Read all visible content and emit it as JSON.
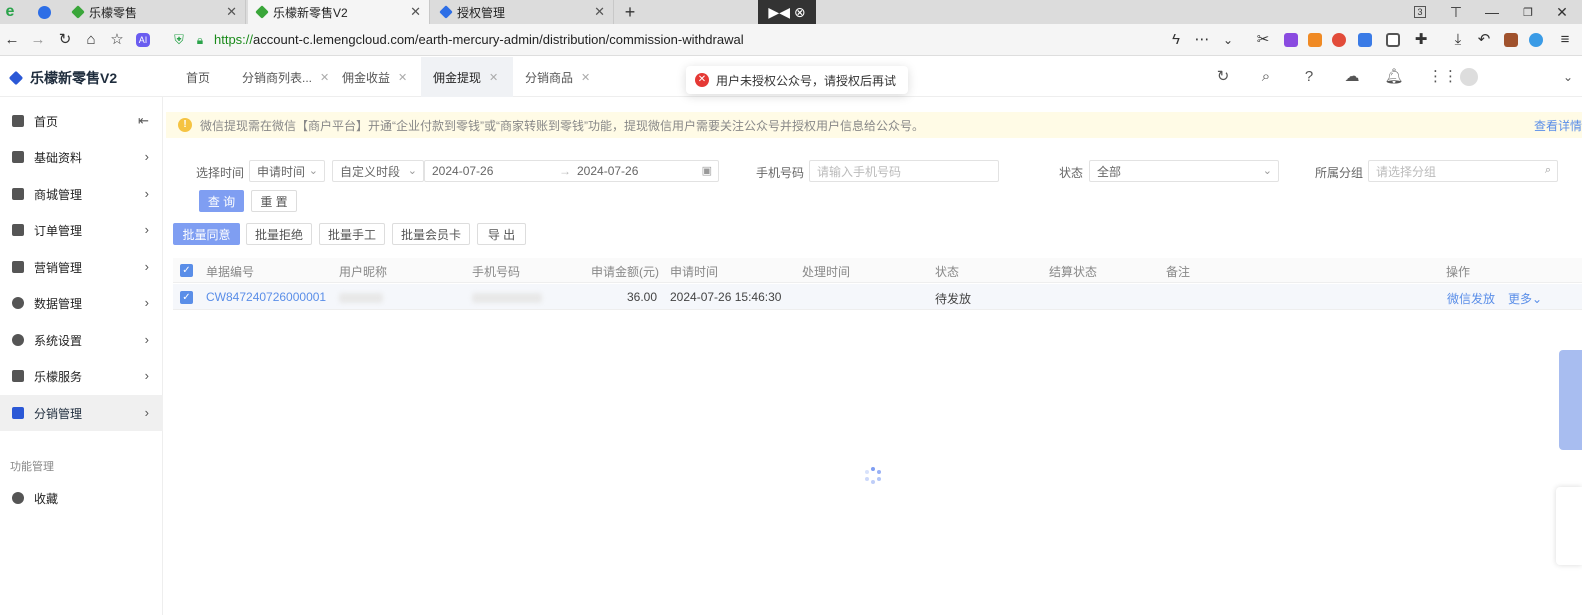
{
  "browser": {
    "tabs": [
      {
        "label": "乐檬零售"
      },
      {
        "label": "乐檬新零售V2"
      },
      {
        "label": "授权管理"
      }
    ],
    "tab_count_badge": "3",
    "url_scheme": "https://",
    "url_rest": "account-c.lemengcloud.com/earth-mercury-admin/distribution/commission-withdrawal"
  },
  "app": {
    "logo": "乐檬新零售V2",
    "page_tabs": [
      {
        "label": "首页",
        "closable": false
      },
      {
        "label": "分销商列表...",
        "closable": true
      },
      {
        "label": "佣金收益",
        "closable": true
      },
      {
        "label": "佣金提现",
        "closable": true,
        "active": true
      },
      {
        "label": "分销商品",
        "closable": true
      }
    ],
    "toast": "用户未授权公众号，请授权后再试"
  },
  "sidebar": {
    "items": [
      {
        "label": "首页",
        "icon": "home-icon"
      },
      {
        "label": "基础资料",
        "icon": "box-icon"
      },
      {
        "label": "商城管理",
        "icon": "shop-icon"
      },
      {
        "label": "订单管理",
        "icon": "order-icon"
      },
      {
        "label": "营销管理",
        "icon": "marketing-icon"
      },
      {
        "label": "数据管理",
        "icon": "pie-icon"
      },
      {
        "label": "系统设置",
        "icon": "settings-icon"
      },
      {
        "label": "乐檬服务",
        "icon": "service-icon"
      },
      {
        "label": "分销管理",
        "icon": "distribution-icon",
        "active": true
      }
    ],
    "group_label": "功能管理",
    "favorites": "收藏"
  },
  "notice": {
    "text": "微信提现需在微信【商户平台】开通“企业付款到零钱”或“商家转账到零钱”功能，提现微信用户需要关注公众号并授权用户信息给公众号。",
    "more": "查看详情"
  },
  "filters": {
    "time_label": "选择时间",
    "time_type": "申请时间",
    "period": "自定义时段",
    "date_start": "2024-07-26",
    "date_sep": "→",
    "date_end": "2024-07-26",
    "phone_label": "手机号码",
    "phone_placeholder": "请输入手机号码",
    "status_label": "状态",
    "status_value": "全部",
    "group_label": "所属分组",
    "group_placeholder": "请选择分组",
    "query": "查 询",
    "reset": "重 置"
  },
  "actions": {
    "batch_approve": "批量同意",
    "batch_reject": "批量拒绝",
    "batch_manual": "批量手工",
    "batch_card": "批量会员卡",
    "export": "导 出"
  },
  "table": {
    "columns": [
      "单据编号",
      "用户昵称",
      "手机号码",
      "申请金额(元)",
      "申请时间",
      "处理时间",
      "状态",
      "结算状态",
      "备注",
      "操作"
    ],
    "rows": [
      {
        "id": "CW847240726000001",
        "amount": "36.00",
        "apply_time": "2024-07-26 15:46:30",
        "status": "待发放",
        "op_wechat": "微信发放",
        "op_more": "更多"
      }
    ]
  }
}
